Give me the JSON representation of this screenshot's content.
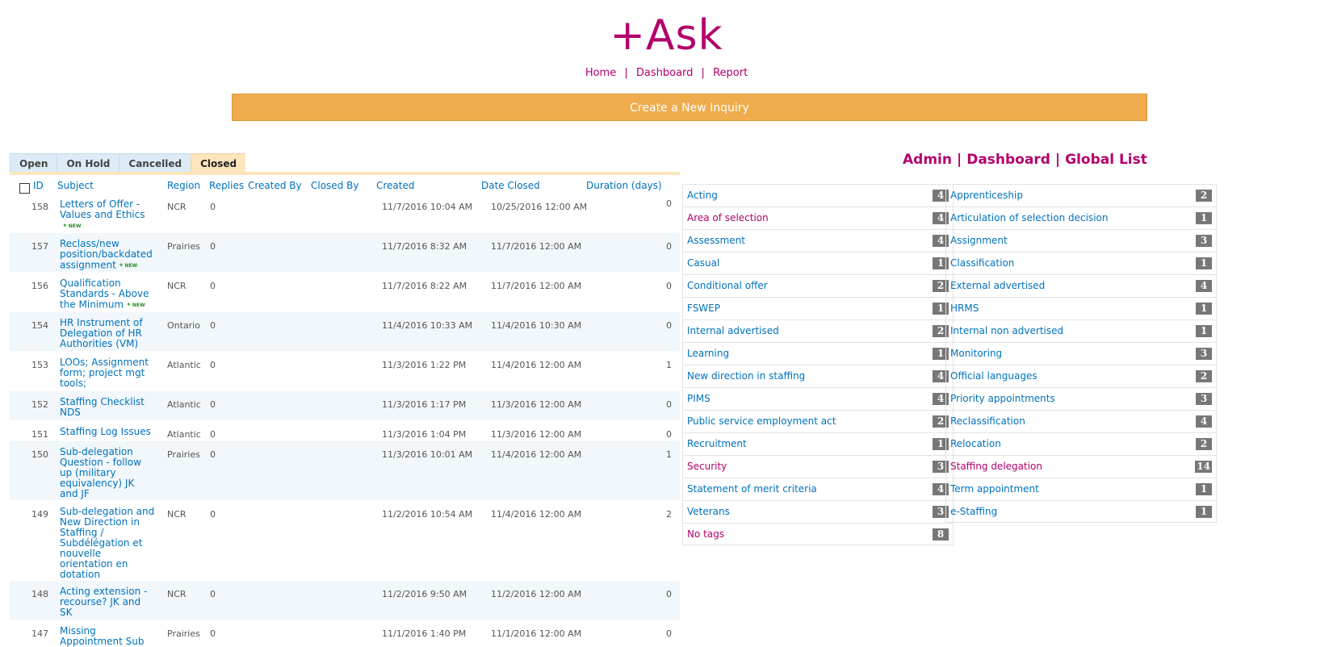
{
  "app": {
    "logo": "+Ask"
  },
  "nav": {
    "home": "Home",
    "dashboard": "Dashboard",
    "report": "Report",
    "sep": "|"
  },
  "new_inquiry_label": "Create a New Inquiry",
  "tabs": [
    "Open",
    "On Hold",
    "Cancelled",
    "Closed"
  ],
  "active_tab": "Closed",
  "columns": {
    "id": "ID",
    "subject": "Subject",
    "region": "Region",
    "replies": "Replies",
    "created_by": "Created By",
    "closed_by": "Closed By",
    "created": "Created",
    "date_closed": "Date Closed",
    "duration": "Duration (days)"
  },
  "new_badge": "NEW",
  "rows": [
    {
      "id": "158",
      "subject": "Letters of Offer - Values and Ethics",
      "new": true,
      "region": "NCR",
      "replies": "0",
      "created": "11/7/2016 10:04 AM",
      "closed": "10/25/2016 12:00 AM",
      "duration": "0"
    },
    {
      "id": "157",
      "subject": "Reclass/new position/backdated assignment",
      "new": true,
      "region": "Prairies",
      "replies": "0",
      "created": "11/7/2016 8:32 AM",
      "closed": "11/7/2016 12:00 AM",
      "duration": "0"
    },
    {
      "id": "156",
      "subject": "Qualification Standards - Above the Minimum",
      "new": true,
      "region": "NCR",
      "replies": "0",
      "created": "11/7/2016 8:22 AM",
      "closed": "11/7/2016 12:00 AM",
      "duration": "0"
    },
    {
      "id": "154",
      "subject": "HR Instrument of Delegation of HR Authorities (VM)",
      "new": false,
      "region": "Ontario",
      "replies": "0",
      "created": "11/4/2016 10:33 AM",
      "closed": "11/4/2016 10:30 AM",
      "duration": "0"
    },
    {
      "id": "153",
      "subject": "LOOs; Assignment form; project mgt tools;",
      "new": false,
      "region": "Atlantic",
      "replies": "0",
      "created": "11/3/2016 1:22 PM",
      "closed": "11/4/2016 12:00 AM",
      "duration": "1"
    },
    {
      "id": "152",
      "subject": "Staffing Checklist NDS",
      "new": false,
      "region": "Atlantic",
      "replies": "0",
      "created": "11/3/2016 1:17 PM",
      "closed": "11/3/2016 12:00 AM",
      "duration": "0"
    },
    {
      "id": "151",
      "subject": "Staffing Log Issues",
      "new": false,
      "region": "Atlantic",
      "replies": "0",
      "created": "11/3/2016 1:04 PM",
      "closed": "11/3/2016 12:00 AM",
      "duration": "0"
    },
    {
      "id": "150",
      "subject": "Sub-delegation Question - follow up (military equivalency) JK and JF",
      "new": false,
      "region": "Prairies",
      "replies": "0",
      "created": "11/3/2016 10:01 AM",
      "closed": "11/4/2016 12:00 AM",
      "duration": "1"
    },
    {
      "id": "149",
      "subject": "Sub-delegation and New Direction in Staffing / Subdélégation et nouvelle orientation en dotation",
      "new": false,
      "region": "NCR",
      "replies": "0",
      "created": "11/2/2016 10:54 AM",
      "closed": "11/4/2016 12:00 AM",
      "duration": "2"
    },
    {
      "id": "148",
      "subject": "Acting extension - recourse? JK and SK",
      "new": false,
      "region": "NCR",
      "replies": "0",
      "created": "11/2/2016 9:50 AM",
      "closed": "11/2/2016 12:00 AM",
      "duration": "0"
    },
    {
      "id": "147",
      "subject": "Missing Appointment Sub",
      "new": false,
      "region": "Prairies",
      "replies": "0",
      "created": "11/1/2016 1:40 PM",
      "closed": "11/1/2016 12:00 AM",
      "duration": "0"
    }
  ],
  "admin_links": {
    "admin": "Admin",
    "dashboard": "Dashboard",
    "global_list": "Global List",
    "sep": "|"
  },
  "tags_left": [
    {
      "name": "Acting",
      "count": "4",
      "highlight": false
    },
    {
      "name": "Area of selection",
      "count": "4",
      "highlight": true
    },
    {
      "name": "Assessment",
      "count": "4",
      "highlight": false
    },
    {
      "name": "Casual",
      "count": "1",
      "highlight": false
    },
    {
      "name": "Conditional offer",
      "count": "2",
      "highlight": false
    },
    {
      "name": "FSWEP",
      "count": "1",
      "highlight": false
    },
    {
      "name": "Internal advertised",
      "count": "2",
      "highlight": false
    },
    {
      "name": "Learning",
      "count": "1",
      "highlight": false
    },
    {
      "name": "New direction in staffing",
      "count": "4",
      "highlight": false
    },
    {
      "name": "PIMS",
      "count": "4",
      "highlight": false
    },
    {
      "name": "Public service employment act",
      "count": "2",
      "highlight": false
    },
    {
      "name": "Recruitment",
      "count": "1",
      "highlight": false
    },
    {
      "name": "Security",
      "count": "3",
      "highlight": true
    },
    {
      "name": "Statement of merit criteria",
      "count": "4",
      "highlight": false
    },
    {
      "name": "Veterans",
      "count": "3",
      "highlight": false
    },
    {
      "name": "No tags",
      "count": "8",
      "highlight": true
    }
  ],
  "tags_right": [
    {
      "name": "Apprenticeship",
      "count": "2",
      "highlight": false
    },
    {
      "name": "Articulation of selection decision",
      "count": "1",
      "highlight": false
    },
    {
      "name": "Assignment",
      "count": "3",
      "highlight": false
    },
    {
      "name": "Classification",
      "count": "1",
      "highlight": false
    },
    {
      "name": "External advertised",
      "count": "4",
      "highlight": false
    },
    {
      "name": "HRMS",
      "count": "1",
      "highlight": false
    },
    {
      "name": "Internal non advertised",
      "count": "1",
      "highlight": false
    },
    {
      "name": "Monitoring",
      "count": "3",
      "highlight": false
    },
    {
      "name": "Official languages",
      "count": "2",
      "highlight": false
    },
    {
      "name": "Priority appointments",
      "count": "3",
      "highlight": false
    },
    {
      "name": "Reclassification",
      "count": "4",
      "highlight": false
    },
    {
      "name": "Relocation",
      "count": "2",
      "highlight": false
    },
    {
      "name": "Staffing delegation",
      "count": "14",
      "highlight": true
    },
    {
      "name": "Term appointment",
      "count": "1",
      "highlight": false
    },
    {
      "name": "e-Staffing",
      "count": "1",
      "highlight": false
    }
  ]
}
